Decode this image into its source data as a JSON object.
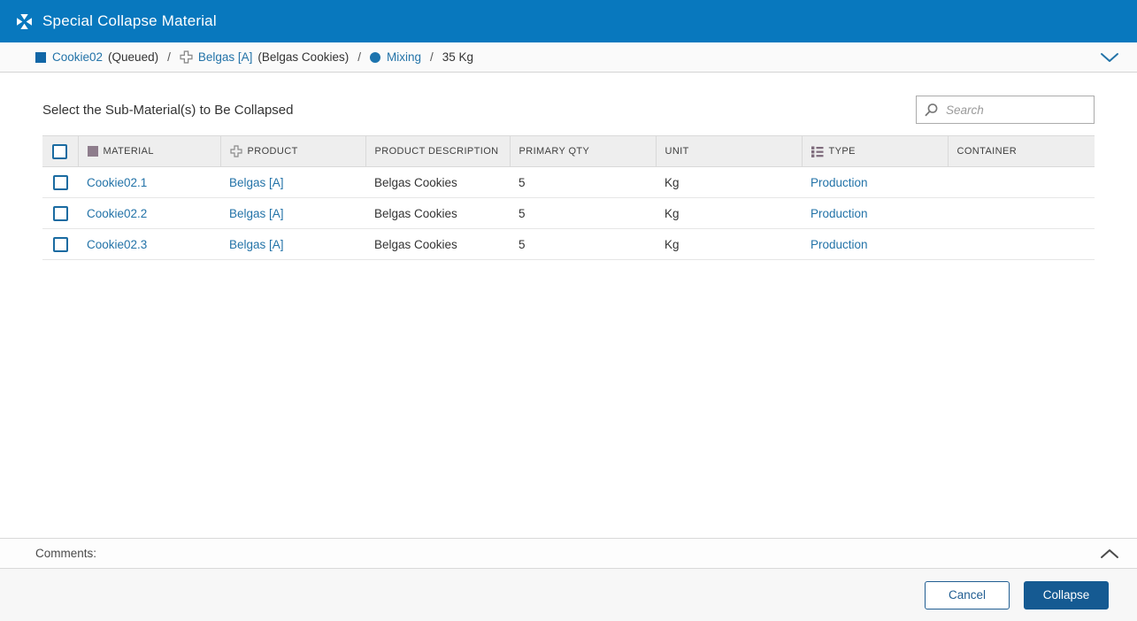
{
  "title_bar": {
    "title": "Special Collapse Material"
  },
  "breadcrumb": {
    "separator": "/",
    "items": [
      {
        "label": "Cookie02",
        "status": "(Queued)"
      },
      {
        "label": "Belgas [A]",
        "description": "(Belgas Cookies)"
      },
      {
        "label": "Mixing"
      },
      {
        "quantity": "35 Kg"
      }
    ]
  },
  "main": {
    "heading": "Select the Sub-Material(s) to Be Collapsed",
    "search_placeholder": "Search"
  },
  "table": {
    "columns": [
      {
        "label": "MATERIAL",
        "icon": "material-square-icon"
      },
      {
        "label": "PRODUCT",
        "icon": "product-icon"
      },
      {
        "label": "PRODUCT DESCRIPTION"
      },
      {
        "label": "PRIMARY QTY"
      },
      {
        "label": "UNIT"
      },
      {
        "label": "TYPE",
        "icon": "list-icon"
      },
      {
        "label": "CONTAINER"
      }
    ],
    "rows": [
      {
        "material": "Cookie02.1",
        "product": "Belgas [A]",
        "product_description": "Belgas Cookies",
        "primary_qty": "5",
        "unit": "Kg",
        "type": "Production",
        "container": ""
      },
      {
        "material": "Cookie02.2",
        "product": "Belgas [A]",
        "product_description": "Belgas Cookies",
        "primary_qty": "5",
        "unit": "Kg",
        "type": "Production",
        "container": ""
      },
      {
        "material": "Cookie02.3",
        "product": "Belgas [A]",
        "product_description": "Belgas Cookies",
        "primary_qty": "5",
        "unit": "Kg",
        "type": "Production",
        "container": ""
      }
    ]
  },
  "comments": {
    "label": "Comments:"
  },
  "footer": {
    "cancel_label": "Cancel",
    "collapse_label": "Collapse"
  },
  "colors": {
    "titlebar_bg": "#0878be",
    "link": "#2373a8",
    "primary_button_bg": "#155a92",
    "header_bg": "#eeeeee"
  }
}
